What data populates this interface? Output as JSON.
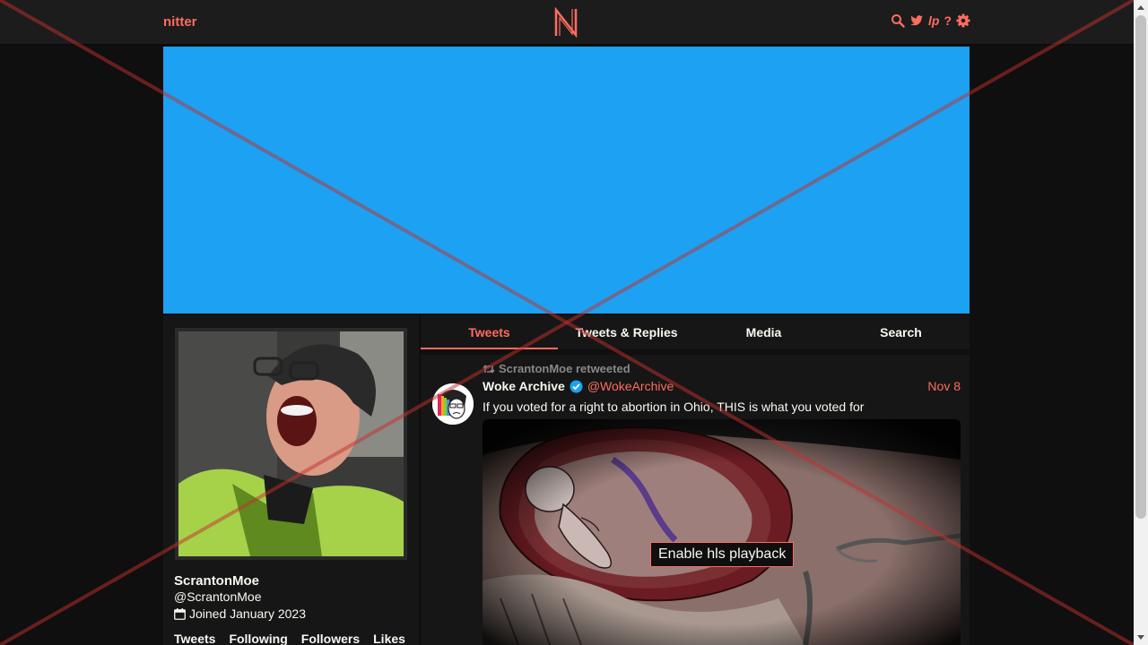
{
  "nav": {
    "brand": "nitter",
    "logo_letter": "N",
    "icons": [
      "search-icon",
      "twitter-bird-icon",
      "liberapay-icon",
      "help-icon",
      "settings-gear-icon"
    ],
    "liberapay_label": "lp",
    "help_label": "?"
  },
  "profile": {
    "fullname": "ScrantonMoe",
    "username": "@ScrantonMoe",
    "joined": "Joined January 2023",
    "stats": [
      "Tweets",
      "Following",
      "Followers",
      "Likes"
    ]
  },
  "tabs": [
    "Tweets",
    "Tweets & Replies",
    "Media",
    "Search"
  ],
  "active_tab": "Tweets",
  "tweet": {
    "retweet_header": "ScrantonMoe retweeted",
    "fullname": "Woke Archive",
    "username": "@WokeArchive",
    "date": "Nov 8",
    "text": "If you voted for a right to abortion in Ohio, THIS is what you voted for",
    "hls_button": "Enable hls playback"
  },
  "colors": {
    "accent": "#ff6c60",
    "background": "#0f0f0f",
    "banner": "#1da1f2",
    "verified": "#1da1f2"
  }
}
